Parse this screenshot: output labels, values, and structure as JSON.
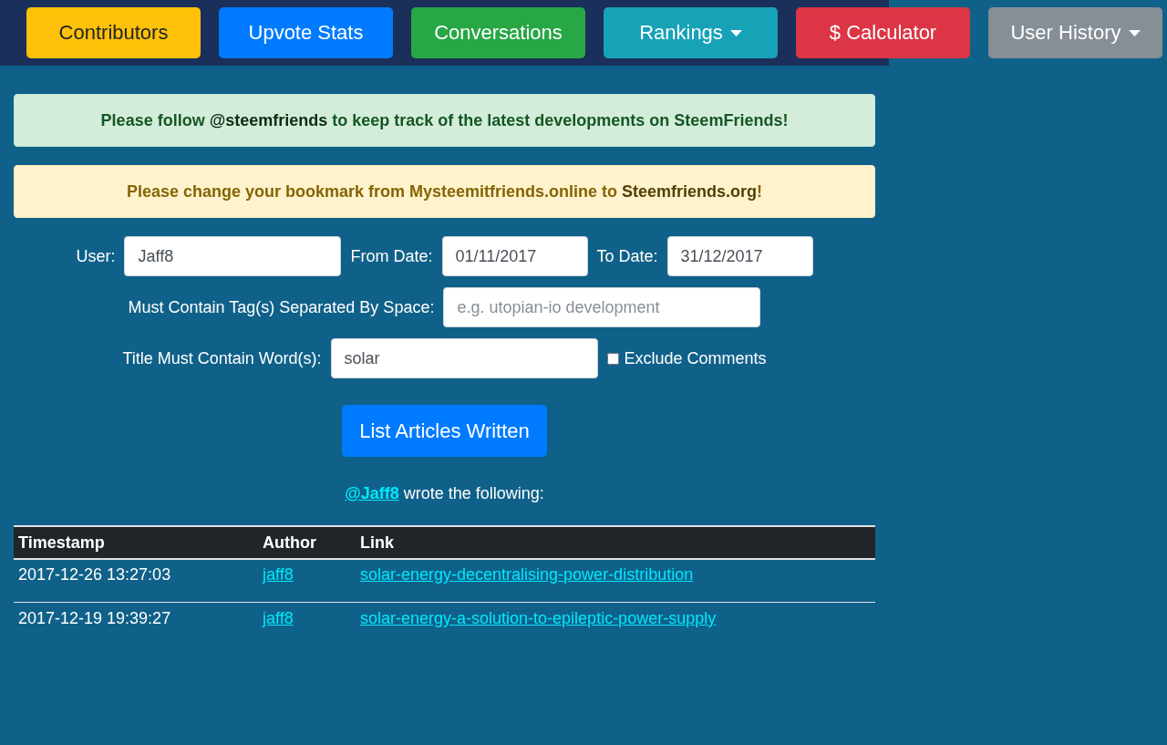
{
  "nav": {
    "buttons": [
      {
        "label": "Contributors",
        "color": "#ffc107",
        "dropdown": false
      },
      {
        "label": "Upvote Stats",
        "color": "#007bff",
        "dropdown": false
      },
      {
        "label": "Conversations",
        "color": "#28a745",
        "dropdown": false
      },
      {
        "label": "Rankings",
        "color": "#17a2b8",
        "dropdown": true
      },
      {
        "label": "$ Calculator",
        "color": "#dc3545",
        "dropdown": false
      },
      {
        "label": "User History",
        "color": "#868e96",
        "dropdown": true
      }
    ]
  },
  "alerts": [
    {
      "kind": "success",
      "before": "Please follow ",
      "link": "@steemfriends",
      "after": " to keep track of the latest developments on SteemFriends!"
    },
    {
      "kind": "warning",
      "before": "Please change your bookmark from Mysteemitfriends.online to ",
      "link": "Steemfriends.org",
      "after": "!"
    }
  ],
  "form": {
    "user": {
      "label": "User:",
      "value": "Jaff8"
    },
    "from_date": {
      "label": "From Date:",
      "value": "01/11/2017"
    },
    "to_date": {
      "label": "To Date:",
      "value": "31/12/2017"
    },
    "tags": {
      "label": "Must Contain Tag(s) Separated By Space:",
      "placeholder": "e.g. utopian-io development"
    },
    "title_words": {
      "label": "Title Must Contain Word(s):",
      "value": "solar"
    },
    "exclude_comments": {
      "label": "Exclude Comments",
      "checked": false
    },
    "submit": "List Articles Written"
  },
  "result": {
    "user_link": "@Jaff8",
    "text": " wrote the following:"
  },
  "table": {
    "columns": [
      "Timestamp",
      "Author",
      "Link"
    ],
    "rows": [
      [
        "2017-12-26 13:27:03",
        "jaff8",
        "solar-energy-decentralising-power-distribution"
      ],
      [
        "2017-12-19 19:39:27",
        "jaff8",
        "solar-energy-a-solution-to-epileptic-power-supply"
      ]
    ]
  }
}
